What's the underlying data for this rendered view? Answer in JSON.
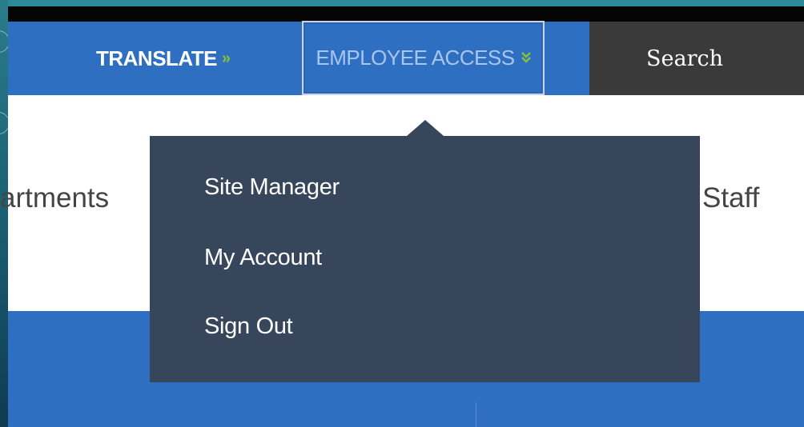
{
  "header": {
    "translate_label": "TRANSLATE",
    "translate_chevron": "»",
    "employee_access_label": "EMPLOYEE ACCESS",
    "employee_access_chevron": "»",
    "search_label": "Search"
  },
  "main_nav": {
    "left_item_partial": "artments",
    "right_item_partial": "Staff"
  },
  "employee_menu": {
    "items": [
      {
        "label": "Site Manager"
      },
      {
        "label": "My Account"
      },
      {
        "label": "Sign Out"
      }
    ]
  },
  "colors": {
    "nav_blue": "#2f6fc1",
    "search_bg": "#3a3a3a",
    "dropdown_bg": "#38465c",
    "accent_green": "#86c232"
  },
  "icons": {
    "translate_chevron": "double-chevron-right-icon",
    "employee_access_chevron": "double-chevron-down-icon",
    "dropdown_caret": "caret-up-icon"
  }
}
